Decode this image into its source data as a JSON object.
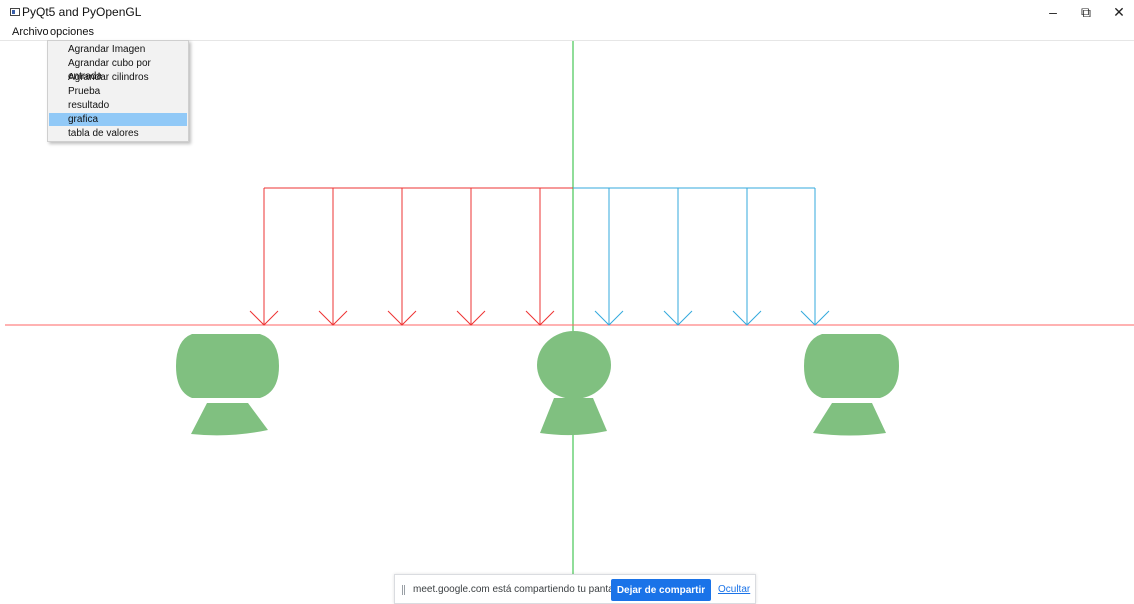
{
  "window": {
    "title": "PyQt5 and PyOpenGL",
    "minimize_glyph": "–",
    "restore_glyph": "⧉",
    "close_glyph": "✕"
  },
  "menubar": {
    "items": [
      "Archivo",
      "opciones"
    ]
  },
  "dropdown": {
    "items": [
      "Agrandar Imagen",
      "Agrandar cubo por entrada",
      "Agrandar cilindros",
      "Prueba",
      "resultado",
      "grafica",
      "tabla de valores"
    ],
    "highlighted_index": 5
  },
  "scene": {
    "colors": {
      "axis_vertical": "#22bb33",
      "axis_horizontal": "#ff6666",
      "arrows_left": "#ee3333",
      "arrows_right": "#33aadd",
      "supports": "#80c080"
    },
    "arrow_count_left": 5,
    "arrow_count_right": 4
  },
  "share_bar": {
    "message": "meet.google.com está compartiendo tu pantalla.",
    "stop_label": "Dejar de compartir",
    "hide_label": "Ocultar"
  }
}
